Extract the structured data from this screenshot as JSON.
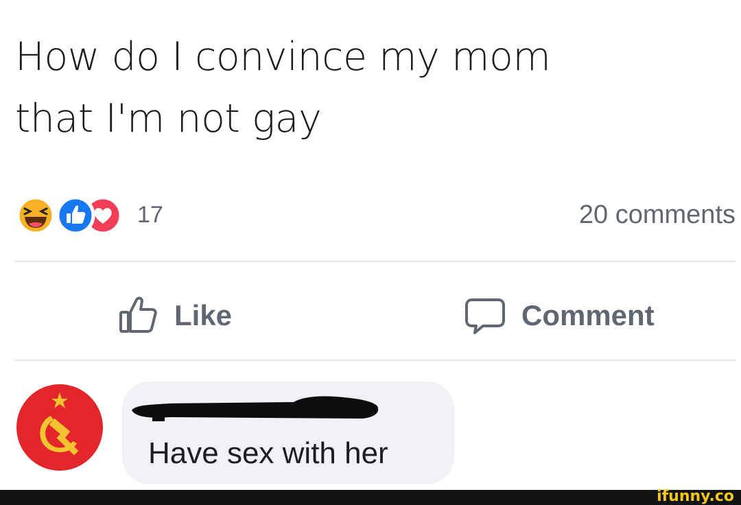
{
  "post": {
    "text_line1": "How do I convince my mom",
    "text_line2": "that I'm not gay"
  },
  "reactions": {
    "icons": [
      "haha-icon",
      "like-icon",
      "love-icon"
    ],
    "count": "17"
  },
  "comments_count": "20 comments",
  "actions": {
    "like_label": "Like",
    "comment_label": "Comment"
  },
  "comment": {
    "author": "",
    "text": "Have sex with her"
  },
  "watermark": "ifunny.co",
  "colors": {
    "like_blue": "#1877f2",
    "love_red": "#f33e58",
    "haha_yellow": "#f7b125",
    "avatar_red": "#e3262a",
    "hammer_sickle_gold": "#f4c430",
    "muted_text": "#606770",
    "bubble_bg": "#f0f2f5"
  }
}
